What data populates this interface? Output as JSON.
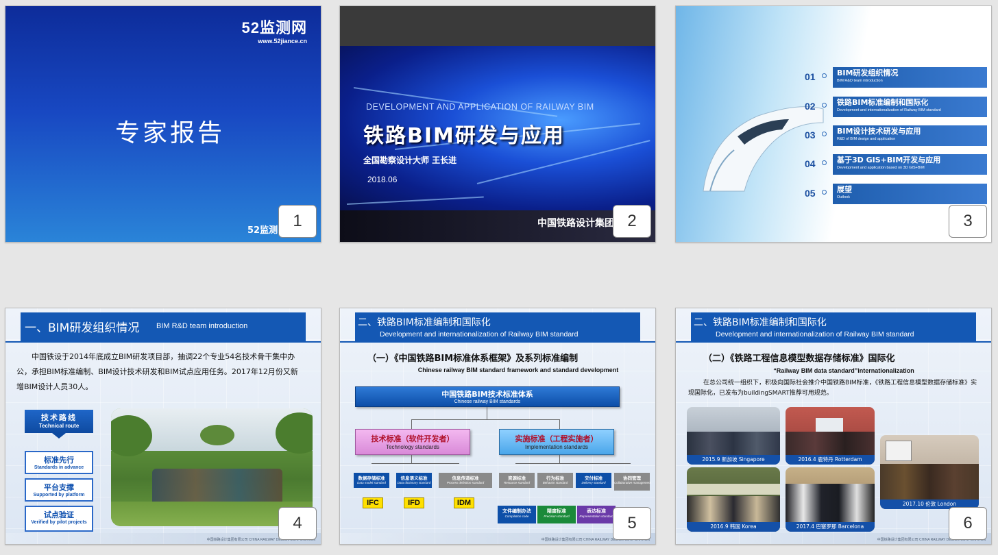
{
  "slides": [
    {
      "number": "1",
      "logo_main": "52监测网",
      "logo_url": "www.52jiance.cn",
      "title": "专家报告",
      "footer": "52监测"
    },
    {
      "number": "2",
      "subtitle_en": "DEVELOPMENT AND APPLICATION OF RAILWAY BIM",
      "title": "铁路BIM研发与应用",
      "author": "全国勘察设计大师    王长进",
      "date": "2018.06",
      "company": "中国铁路设计集团"
    },
    {
      "number": "3",
      "toc": [
        {
          "num": "01",
          "cn": "BIM研发组织情况",
          "en": "BIM R&D team introduction"
        },
        {
          "num": "02",
          "cn": "铁路BIM标准编制和国际化",
          "en": "Development and internationalization of Railway BIM standard"
        },
        {
          "num": "03",
          "cn": "BIM设计技术研发与应用",
          "en": "R&D of BIM design and application"
        },
        {
          "num": "04",
          "cn": "基于3D GIS+BIM开发与应用",
          "en": "Development and application based on 3D GIS+BIM"
        },
        {
          "num": "05",
          "cn": "展望",
          "en": "Outlook"
        }
      ]
    },
    {
      "number": "4",
      "header_cn": "一、BIM研发组织情况",
      "header_en": "BIM R&D team introduction",
      "paragraph": "中国铁设于2014年底成立BIM研发项目部，抽调22个专业54名技术骨干集中办公，承担BIM标准编制、BIM设计技术研发和BIM试点应用任务。2017年12月份又新增BIM设计人员30人。",
      "route_cn": "技术路线",
      "route_en": "Technical route",
      "route_items": [
        {
          "cn": "标准先行",
          "en": "Standards in advance"
        },
        {
          "cn": "平台支撑",
          "en": "Supported by platform"
        },
        {
          "cn": "试点验证",
          "en": "Verified by pilot projects"
        }
      ],
      "footer": "中国铁路设计集团有限公司 CHINA RAILWAY DESIGN CORPORATION"
    },
    {
      "number": "5",
      "header_cn": "二、铁路BIM标准编制和国际化",
      "header_en": "Development and internationalization of Railway BIM standard",
      "h2": "（一）《中国铁路BIM标准体系框架》及系列标准编制",
      "h2_en": "Chinese railway BIM standard framework and standard development",
      "root_cn": "中国铁路BIM技术标准体系",
      "root_en": "Chinese railway BIM standards",
      "tech_cn": "技术标准（软件开发者）",
      "tech_en": "Technology standards",
      "impl_cn": "实施标准（工程实施者）",
      "impl_en": "Implementation standards",
      "leaves": [
        {
          "cn": "数据存储标准",
          "en": "Data model standard"
        },
        {
          "cn": "信息语义标准",
          "en": "Data dictionary standard"
        },
        {
          "cn": "信息传递标准",
          "en": "Process definition standard"
        },
        {
          "cn": "资源标准",
          "en": "Resource standard"
        },
        {
          "cn": "行为标准",
          "en": "Behavior standard"
        },
        {
          "cn": "交付标准",
          "en": "Delivery standard"
        },
        {
          "cn": "协同管理",
          "en": "Collaborative management"
        }
      ],
      "tags": [
        "IFC",
        "IFD",
        "IDM"
      ],
      "subs": [
        {
          "cn": "文件编制办法",
          "en": "Compilation code"
        },
        {
          "cn": "精度标准",
          "en": "Precision standard"
        },
        {
          "cn": "表达标准",
          "en": "Representation standard"
        }
      ],
      "footer": "中国铁路设计集团有限公司 CHINA RAILWAY DESIGN CORPORATION"
    },
    {
      "number": "6",
      "header_cn": "二、铁路BIM标准编制和国际化",
      "header_en": "Development and internationalization of Railway BIM standard",
      "h2": "（二）《铁路工程信息模型数据存储标准》国际化",
      "h2_en": "“Railway BIM data standard”internationalization",
      "paragraph": "在总公司统一组织下，积极向国际社会推介中国铁路BIM标准，《铁路工程信息模型数据存储标准》实现国际化，已发布为buildingSMART推荐可用规范。",
      "photos": [
        "2015.9 新加坡 Singapore",
        "2016.4 鹿特丹 Rotterdam",
        "2017.10 伦敦 London",
        "2016.9 韩国 Korea",
        "2017.4 巴塞罗那 Barcelona"
      ],
      "footer": "中国铁路设计集团有限公司 CHINA RAILWAY DESIGN CORPORATION"
    }
  ]
}
